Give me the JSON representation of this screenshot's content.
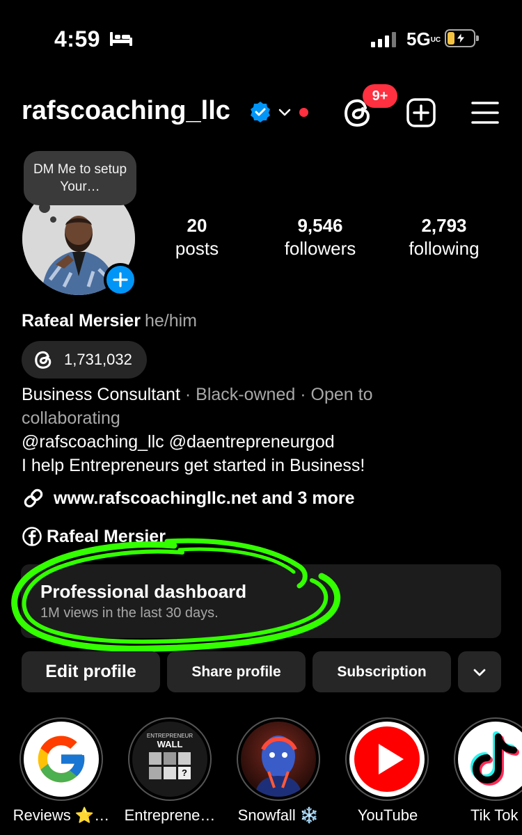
{
  "status_bar": {
    "time": "4:59",
    "network": "5G",
    "network_sup": "UC"
  },
  "header": {
    "username": "rafscoaching_llc",
    "notification_badge": "9+"
  },
  "profile": {
    "note": "DM Me to setup Your…",
    "stats": [
      {
        "value": "20",
        "label": "posts"
      },
      {
        "value": "9,546",
        "label": "followers"
      },
      {
        "value": "2,793",
        "label": "following"
      }
    ],
    "full_name": "Rafeal Mersier",
    "pronouns": "he/him",
    "threads_count": "1,731,032",
    "bio": {
      "category": "Business Consultant",
      "tag1": "Black-owned",
      "tag2": "Open to",
      "tag2_cont": "collaborating",
      "separator": "·",
      "mentions": "@rafscoaching_llc @daentrepreneurgod",
      "tagline": "I help Entrepreneurs get started in Business!"
    },
    "link": "www.rafscoachingllc.net and 3 more",
    "facebook_name": "Rafeal Mersier"
  },
  "dashboard": {
    "title": "Professional dashboard",
    "subtitle": "1M views in the last 30 days."
  },
  "buttons": {
    "edit_profile": "Edit profile",
    "share_profile": "Share profile",
    "subscription": "Subscription"
  },
  "highlights": [
    {
      "label": "Reviews ⭐…"
    },
    {
      "label": "Entreprene…",
      "cover_text": "ENTREPRENEUR",
      "cover_text2": "WALL"
    },
    {
      "label": "Snowfall ❄️"
    },
    {
      "label": "YouTube"
    },
    {
      "label": "Tik Tok"
    }
  ],
  "colors": {
    "background": "#000000",
    "accent_blue": "#0095f6",
    "badge_red": "#ff3040",
    "button_bg": "#262626",
    "highlight_scribble": "#33ff00"
  }
}
